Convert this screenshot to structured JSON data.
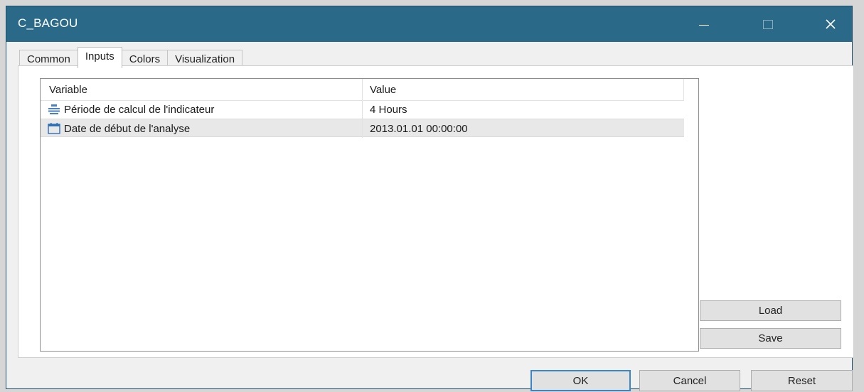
{
  "window": {
    "title": "C_BAGOU",
    "controls": {
      "minimize": "minimize-icon",
      "maximize": "maximize-icon",
      "close": "close-icon"
    }
  },
  "tabs": [
    {
      "label": "Common",
      "active": false
    },
    {
      "label": "Inputs",
      "active": true
    },
    {
      "label": "Colors",
      "active": false
    },
    {
      "label": "Visualization",
      "active": false
    }
  ],
  "grid": {
    "columns": [
      "Variable",
      "Value"
    ],
    "rows": [
      {
        "icon": "enum-list-icon",
        "variable": "Période de calcul de l'indicateur",
        "value": "4 Hours",
        "selected": false
      },
      {
        "icon": "calendar-icon",
        "variable": "Date de début de l'analyse",
        "value": "2013.01.01 00:00:00",
        "selected": true
      }
    ]
  },
  "side_buttons": {
    "load": "Load",
    "save": "Save"
  },
  "footer_buttons": {
    "ok": "OK",
    "cancel": "Cancel",
    "reset": "Reset"
  },
  "colors": {
    "titlebar": "#2b6988",
    "selected_row": "#e8e8e8",
    "default_button_border": "#3a86c8"
  }
}
